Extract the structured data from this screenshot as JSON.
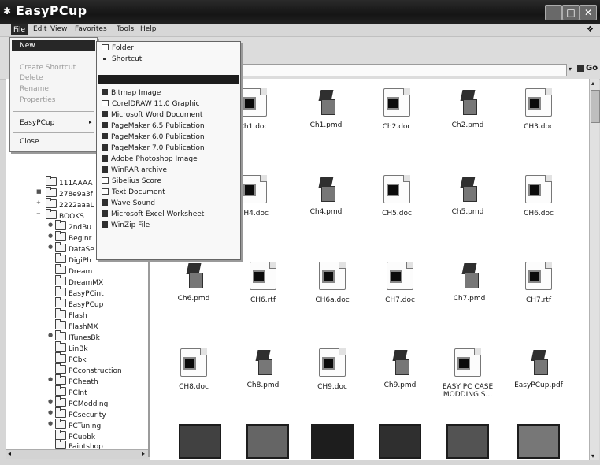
{
  "window": {
    "title": "EasyPCup"
  },
  "menubar": [
    "File",
    "Edit",
    "View",
    "Favorites",
    "Tools",
    "Help"
  ],
  "file_menu": {
    "items": [
      {
        "label": "New",
        "disabled": false
      },
      {
        "label": "Create Shortcut",
        "disabled": true
      },
      {
        "label": "Delete",
        "disabled": true
      },
      {
        "label": "Rename",
        "disabled": true
      },
      {
        "label": "Properties",
        "disabled": true
      },
      {
        "label": "EasyPCup",
        "disabled": false
      },
      {
        "label": "Close",
        "disabled": false
      }
    ]
  },
  "new_submenu": {
    "items": [
      {
        "label": "Folder"
      },
      {
        "label": "Shortcut"
      },
      {
        "label": ""
      },
      {
        "label": "Bitmap Image"
      },
      {
        "label": "CorelDRAW 11.0 Graphic"
      },
      {
        "label": "Microsoft Word Document"
      },
      {
        "label": "PageMaker 6.5 Publication"
      },
      {
        "label": "PageMaker 6.0 Publication"
      },
      {
        "label": "PageMaker 7.0 Publication"
      },
      {
        "label": "Adobe Photoshop Image"
      },
      {
        "label": "WinRAR archive"
      },
      {
        "label": "Sibelius Score"
      },
      {
        "label": "Text Document"
      },
      {
        "label": "Wave Sound"
      },
      {
        "label": "Microsoft Excel Worksheet"
      },
      {
        "label": "WinZip File"
      }
    ]
  },
  "address": {
    "go_label": "Go"
  },
  "tree": {
    "items": [
      "111AAAA",
      "278e9a3f",
      "2222aaaL",
      "BOOKS",
      "2ndBu",
      "Beginr",
      "DataSe",
      "DigiPh",
      "Dream",
      "DreamMX",
      "EasyPCint",
      "EasyPCup",
      "Flash",
      "FlashMX",
      "ITunesBk",
      "LinBk",
      "PCbk",
      "PCconstruction",
      "PCheath",
      "PCInt",
      "PCModding",
      "PCsecurity",
      "PCTuning",
      "PCupbk",
      "Paintshop"
    ]
  },
  "files": [
    {
      "name": "Ch1.doc",
      "type": "doc"
    },
    {
      "name": "Ch1.pmd",
      "type": "pmd"
    },
    {
      "name": "Ch2.doc",
      "type": "doc"
    },
    {
      "name": "Ch2.pmd",
      "type": "pmd"
    },
    {
      "name": "CH3.doc",
      "type": "doc"
    },
    {
      "name": "CH4.doc",
      "type": "doc"
    },
    {
      "name": "Ch4.pmd",
      "type": "pmd"
    },
    {
      "name": "CH5.doc",
      "type": "doc"
    },
    {
      "name": "Ch5.pmd",
      "type": "pmd"
    },
    {
      "name": "CH6.doc",
      "type": "doc"
    },
    {
      "name": "Ch6.pmd",
      "type": "pmd"
    },
    {
      "name": "CH6.rtf",
      "type": "doc"
    },
    {
      "name": "CH6a.doc",
      "type": "doc"
    },
    {
      "name": "CH7.doc",
      "type": "doc"
    },
    {
      "name": "Ch7.pmd",
      "type": "pmd"
    },
    {
      "name": "CH7.rtf",
      "type": "doc"
    },
    {
      "name": "CH8.doc",
      "type": "doc"
    },
    {
      "name": "Ch8.pmd",
      "type": "pmd"
    },
    {
      "name": "CH9.doc",
      "type": "doc"
    },
    {
      "name": "Ch9.pmd",
      "type": "pmd"
    },
    {
      "name": "EASY PC CASE MODDING S...",
      "type": "doc"
    },
    {
      "name": "EasyPCup.pdf",
      "type": "pmd"
    }
  ]
}
